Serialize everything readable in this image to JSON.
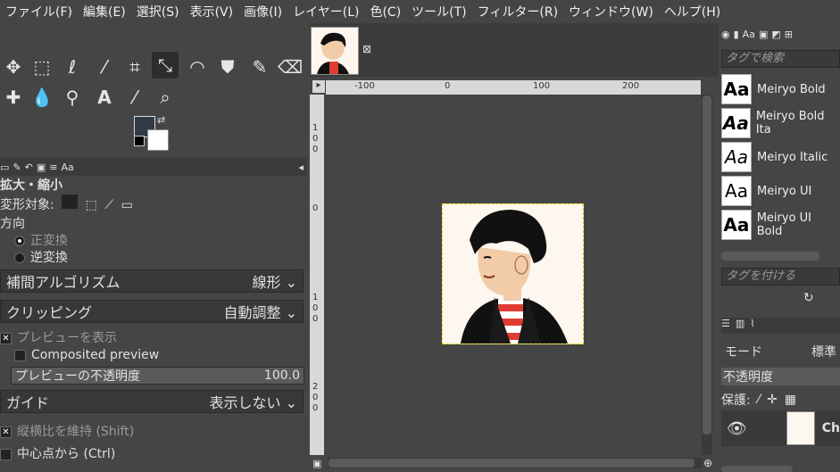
{
  "menu": [
    "ファイル(F)",
    "編集(E)",
    "選択(S)",
    "表示(V)",
    "画像(I)",
    "レイヤー(L)",
    "色(C)",
    "ツール(T)",
    "フィルター(R)",
    "ウィンドウ(W)",
    "ヘルプ(H)"
  ],
  "tool_options": {
    "title": "拡大・縮小",
    "transform_label": "変形対象:",
    "direction_label": "方向",
    "normal": "正変換",
    "reverse": "逆変換",
    "interp_label": "補間アルゴリズム",
    "interp_value": "線形",
    "clip_label": "クリッピング",
    "clip_value": "自動調整",
    "preview_label": "プレビューを表示",
    "composited": "Composited preview",
    "opacity_label": "プレビューの不透明度",
    "opacity_value": "100.0",
    "guide_label": "ガイド",
    "guide_value": "表示しない",
    "keep_aspect": "縦横比を維持 (Shift)",
    "from_center": "中心点から (Ctrl)"
  },
  "ruler": {
    "h": [
      "-100",
      "0",
      "100",
      "200"
    ],
    "v": [
      "1",
      "0",
      "0",
      "0",
      "1",
      "0",
      "0",
      "2",
      "0",
      "0"
    ]
  },
  "fonts": {
    "search_placeholder": "タグで検索",
    "tag_placeholder": "タグを付ける",
    "items": [
      {
        "sample": "Aa",
        "name": "Meiryo Bold"
      },
      {
        "sample": "Aa",
        "name": "Meiryo Bold Ita"
      },
      {
        "sample": "Aa",
        "name": "Meiryo Italic"
      },
      {
        "sample": "Aa",
        "name": "Meiryo UI"
      },
      {
        "sample": "Aa",
        "name": "Meiryo UI Bold"
      }
    ]
  },
  "layers": {
    "mode_label": "モード",
    "mode_value": "標準",
    "opacity_label": "不透明度",
    "lock_label": "保護:",
    "layer_name": "Ch"
  },
  "colors": {
    "fg": "#2f3a45",
    "bg": "#ffffff"
  }
}
